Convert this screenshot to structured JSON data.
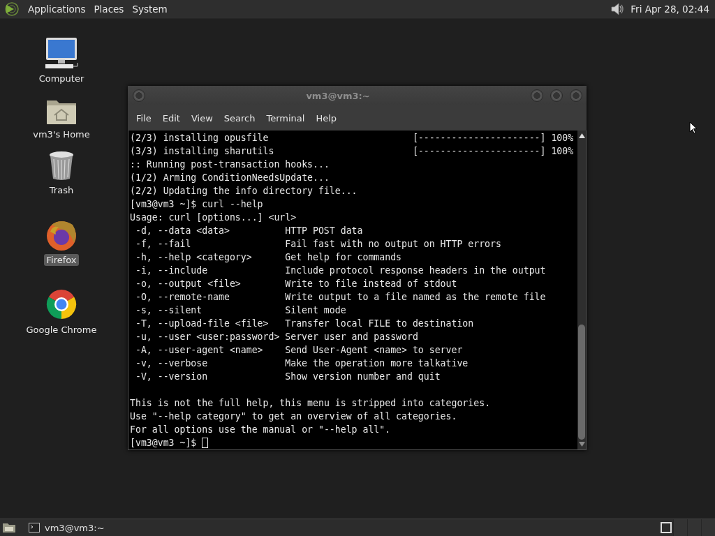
{
  "top_panel": {
    "menus": [
      {
        "label": "Applications"
      },
      {
        "label": "Places"
      },
      {
        "label": "System"
      }
    ],
    "clock": "Fri Apr 28, 02:44"
  },
  "desktop_icons": [
    {
      "kind": "computer",
      "label": "Computer",
      "selected": false
    },
    {
      "kind": "home",
      "label": "vm3's Home",
      "selected": false
    },
    {
      "kind": "trash",
      "label": "Trash",
      "selected": false
    },
    {
      "kind": "firefox",
      "label": "Firefox",
      "selected": true
    },
    {
      "kind": "chrome",
      "label": "Google Chrome",
      "selected": false
    }
  ],
  "terminal": {
    "title": "vm3@vm3:~",
    "menu": [
      "File",
      "Edit",
      "View",
      "Search",
      "Terminal",
      "Help"
    ],
    "lines": [
      {
        "kind": "progress",
        "text": "(2/3) installing opusfile",
        "bar": "[----------------------]",
        "percent": "100%"
      },
      {
        "kind": "progress",
        "text": "(3/3) installing sharutils",
        "bar": "[----------------------]",
        "percent": "100%"
      },
      {
        "kind": "plain",
        "text": ":: Running post-transaction hooks..."
      },
      {
        "kind": "plain",
        "text": "(1/2) Arming ConditionNeedsUpdate..."
      },
      {
        "kind": "plain",
        "text": "(2/2) Updating the info directory file..."
      },
      {
        "kind": "plain",
        "text": "[vm3@vm3 ~]$ curl --help"
      },
      {
        "kind": "plain",
        "text": "Usage: curl [options...] <url>"
      },
      {
        "kind": "option",
        "text": "-d, --data <data>",
        "desc": "HTTP POST data"
      },
      {
        "kind": "option",
        "text": "-f, --fail",
        "desc": "Fail fast with no output on HTTP errors"
      },
      {
        "kind": "option",
        "text": "-h, --help <category>",
        "desc": "Get help for commands"
      },
      {
        "kind": "option",
        "text": "-i, --include",
        "desc": "Include protocol response headers in the output"
      },
      {
        "kind": "option",
        "text": "-o, --output <file>",
        "desc": "Write to file instead of stdout"
      },
      {
        "kind": "option",
        "text": "-O, --remote-name",
        "desc": "Write output to a file named as the remote file"
      },
      {
        "kind": "option",
        "text": "-s, --silent",
        "desc": "Silent mode"
      },
      {
        "kind": "option",
        "text": "-T, --upload-file <file>",
        "desc": "Transfer local FILE to destination"
      },
      {
        "kind": "option",
        "text": "-u, --user <user:password>",
        "desc": "Server user and password"
      },
      {
        "kind": "option",
        "text": "-A, --user-agent <name>",
        "desc": "Send User-Agent <name> to server"
      },
      {
        "kind": "option",
        "text": "-v, --verbose",
        "desc": "Make the operation more talkative"
      },
      {
        "kind": "option",
        "text": "-V, --version",
        "desc": "Show version number and quit"
      },
      {
        "kind": "blank"
      },
      {
        "kind": "plain",
        "text": "This is not the full help, this menu is stripped into categories."
      },
      {
        "kind": "plain",
        "text": "Use \"--help category\" to get an overview of all categories."
      },
      {
        "kind": "plain",
        "text": "For all options use the manual or \"--help all\"."
      },
      {
        "kind": "prompt",
        "text": "[vm3@vm3 ~]$"
      }
    ]
  },
  "taskbar": {
    "tasks": [
      {
        "label": "vm3@vm3:~"
      }
    ],
    "workspaces": [
      {
        "selected": true
      },
      {
        "selected": false
      },
      {
        "selected": false
      },
      {
        "selected": false
      }
    ]
  }
}
